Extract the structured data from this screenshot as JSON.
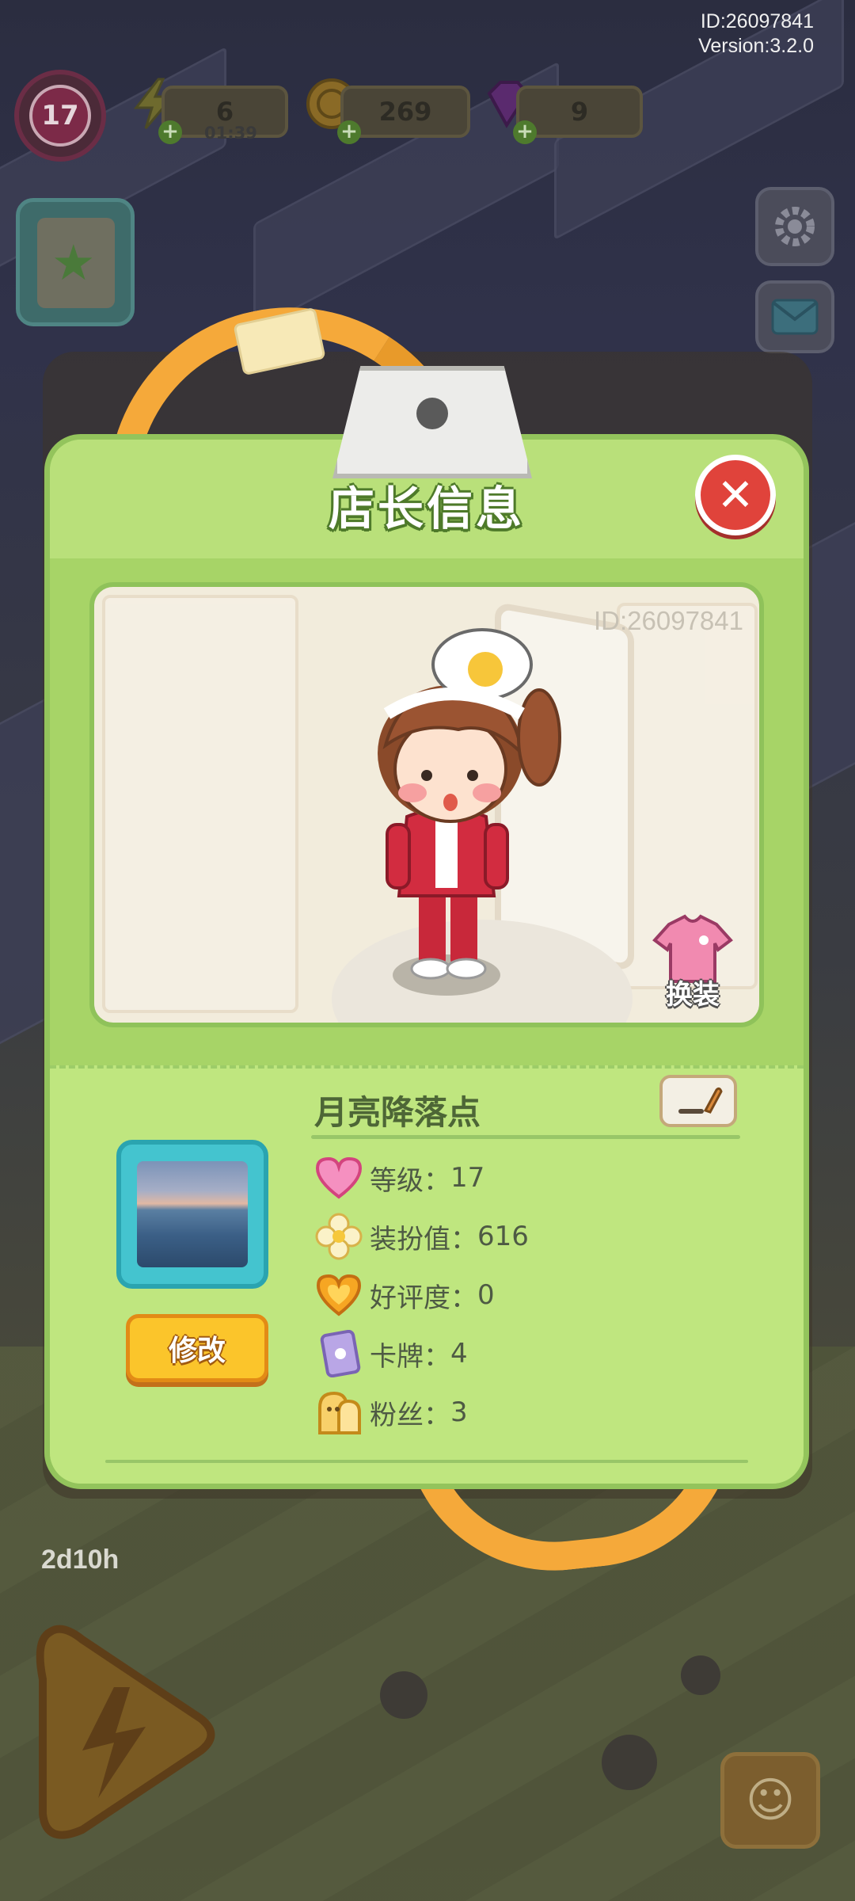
{
  "hud": {
    "id_text": "ID:26097841",
    "version_text": "Version:3.2.0",
    "level": "17",
    "energy": "6",
    "energy_timer": "01:39",
    "coins": "269",
    "gems": "9",
    "plus_glyph": "+",
    "event_timer": "2d10h"
  },
  "card": {
    "title": "店长信息",
    "close_glyph": "✕",
    "portrait_id": "ID:26097841",
    "swap_label": "换装",
    "shop_name": "月亮降落点",
    "modify_label": "修改",
    "stats": [
      {
        "icon": "heart-icon",
        "label": "等级：",
        "value": "17",
        "color": "#f06aa8"
      },
      {
        "icon": "flower-icon",
        "label": "装扮值：",
        "value": "616",
        "color": "#f7e38a"
      },
      {
        "icon": "gold-heart-icon",
        "label": "好评度：",
        "value": "0",
        "color": "#f5a623"
      },
      {
        "icon": "card-icon",
        "label": "卡牌：",
        "value": "4",
        "color": "#a58fd8"
      },
      {
        "icon": "fans-icon",
        "label": "粉丝：",
        "value": "3",
        "color": "#f4c24a"
      }
    ]
  },
  "colors": {
    "card_bg": "#b9e07a",
    "card_border": "#93c45c",
    "close_red": "#e0433b",
    "modify_yellow": "#fbc52b",
    "lanyard_orange": "#f5a93a",
    "avatar_frame": "#44c4cf"
  }
}
